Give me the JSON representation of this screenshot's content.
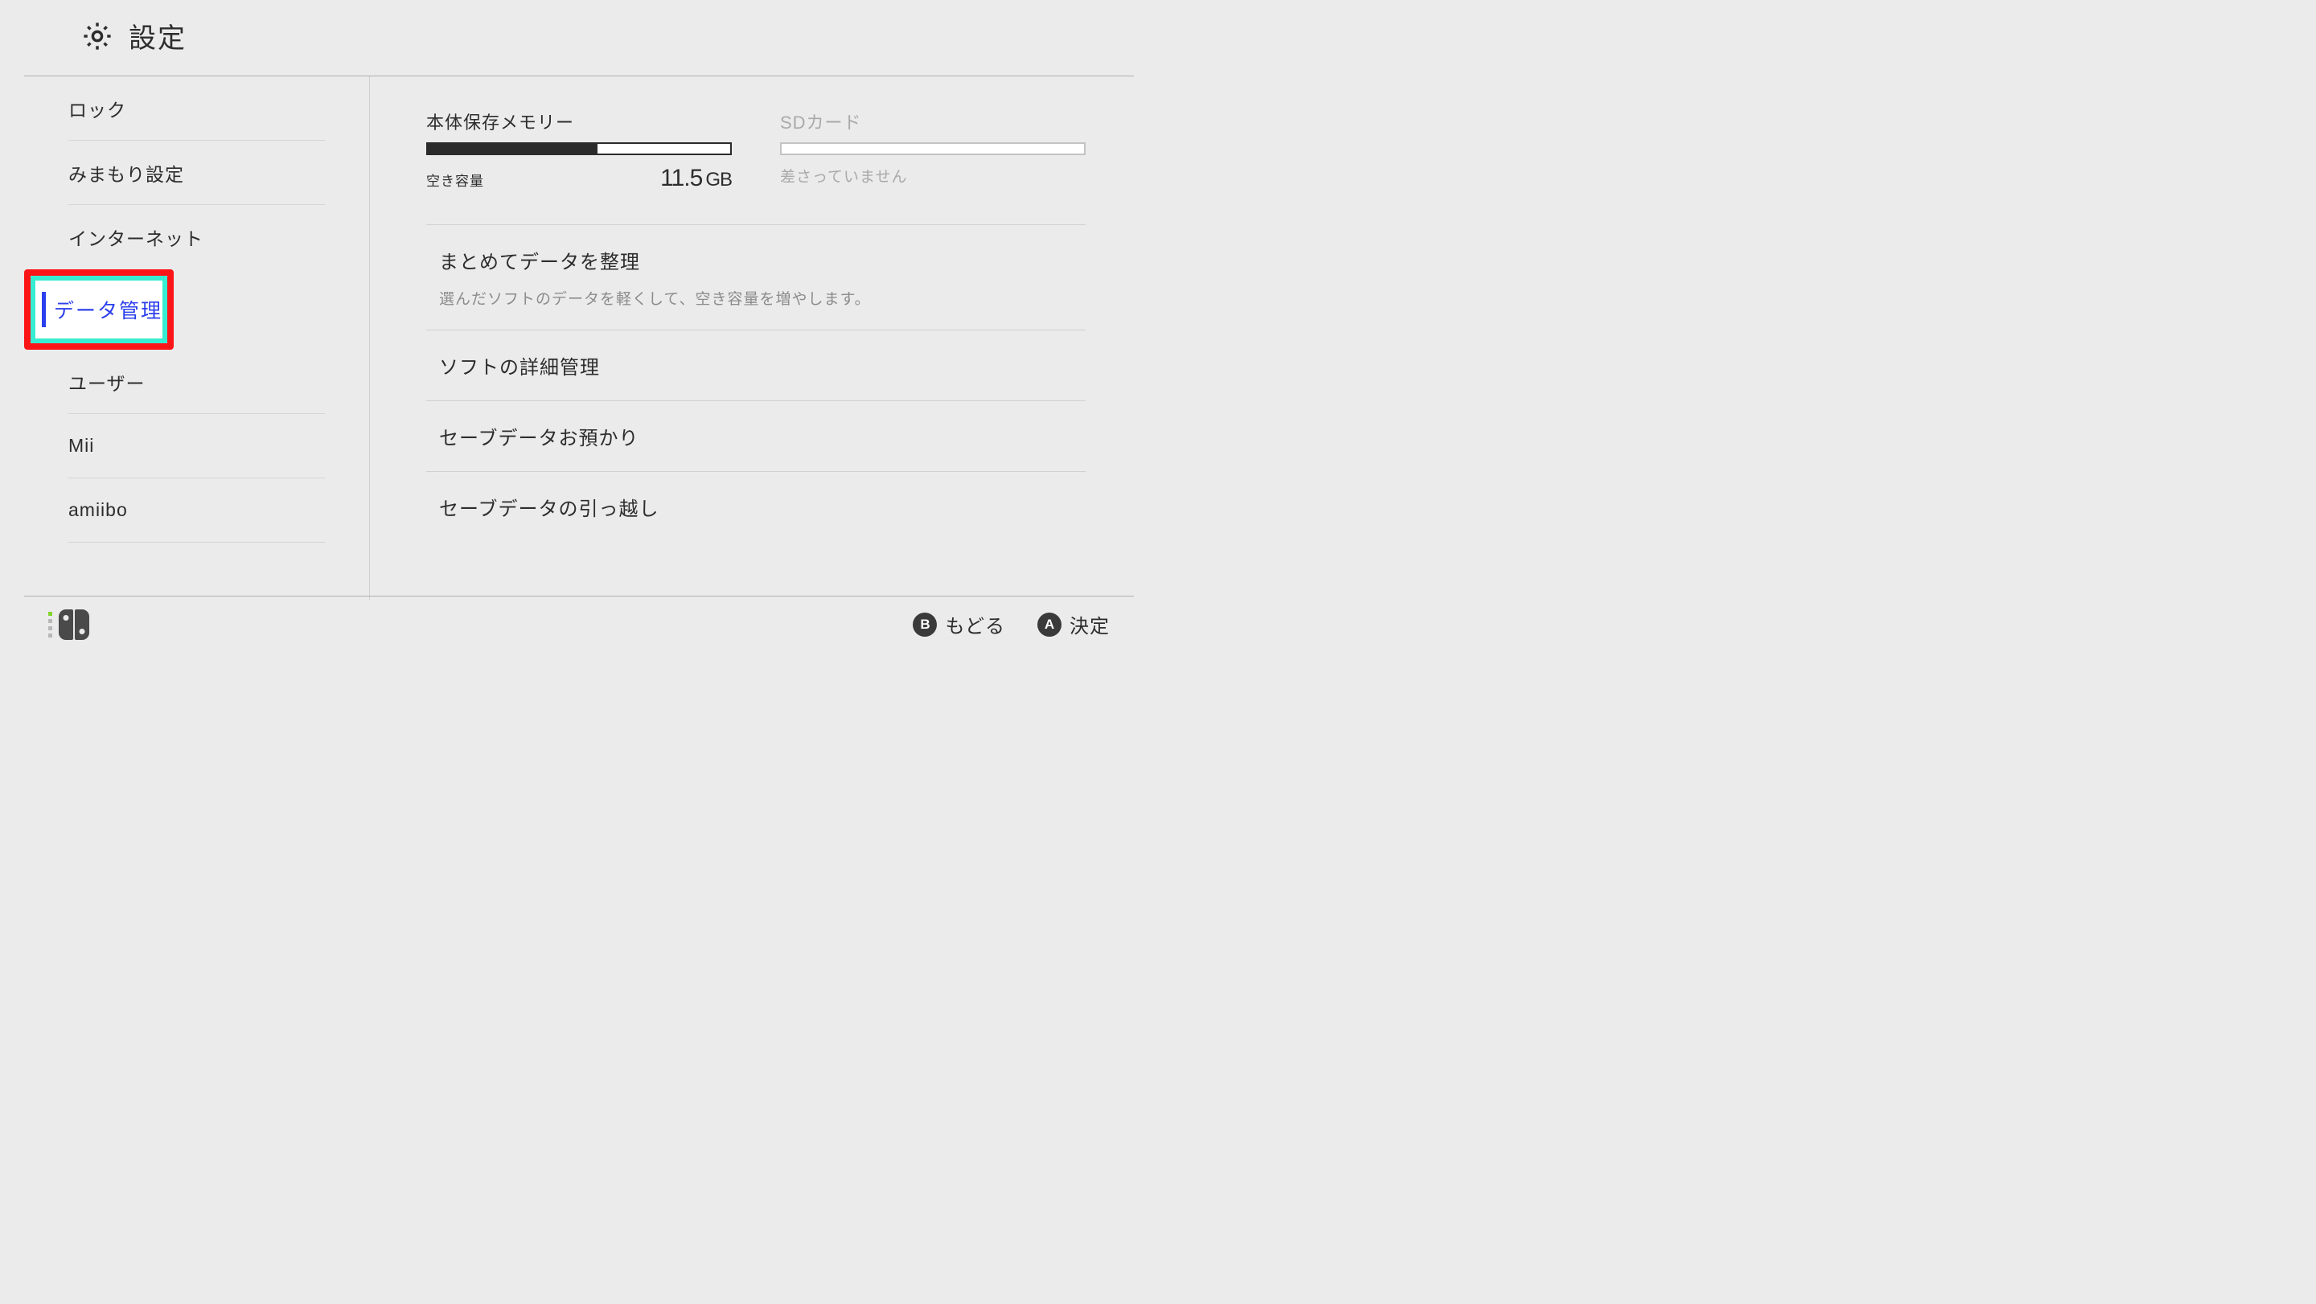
{
  "header": {
    "title": "設定"
  },
  "sidebar": {
    "items": [
      {
        "label": "ロック"
      },
      {
        "label": "みまもり設定"
      },
      {
        "label": "インターネット"
      },
      {
        "label": "データ管理",
        "selected": true
      },
      {
        "label": "ユーザー"
      },
      {
        "label": "Mii"
      },
      {
        "label": "amiibo"
      }
    ]
  },
  "main": {
    "storage": {
      "internal": {
        "title": "本体保存メモリー",
        "free_label": "空き容量",
        "value": "11.5",
        "unit": "GB",
        "fill_percent": 56
      },
      "sd": {
        "title": "SDカード",
        "status": "差さっていません"
      }
    },
    "menu": [
      {
        "title": "まとめてデータを整理",
        "desc": "選んだソフトのデータを軽くして、空き容量を増やします。"
      },
      {
        "title": "ソフトの詳細管理"
      },
      {
        "title": "セーブデータお預かり"
      },
      {
        "title": "セーブデータの引っ越し"
      }
    ]
  },
  "footer": {
    "back": {
      "key": "B",
      "label": "もどる"
    },
    "ok": {
      "key": "A",
      "label": "決定"
    }
  }
}
